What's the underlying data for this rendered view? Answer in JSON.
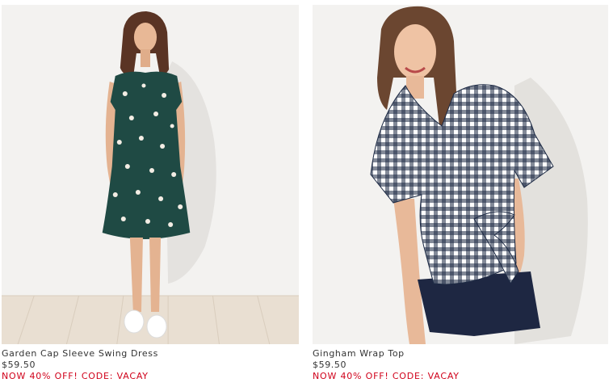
{
  "products": [
    {
      "name": "Garden Cap Sleeve Swing Dress",
      "price": "$59.50",
      "promo": "NOW 40% OFF! CODE: VACAY"
    },
    {
      "name": "Gingham Wrap Top",
      "price": "$59.50",
      "promo": "NOW 40% OFF! CODE: VACAY"
    }
  ],
  "colors": {
    "promo_red": "#d0021b",
    "text": "#333333",
    "dress_green": "#1f4a44",
    "gingham_navy": "#1d2a44",
    "shorts_navy": "#1e2742",
    "floor_wood": "#e8ddd0"
  }
}
